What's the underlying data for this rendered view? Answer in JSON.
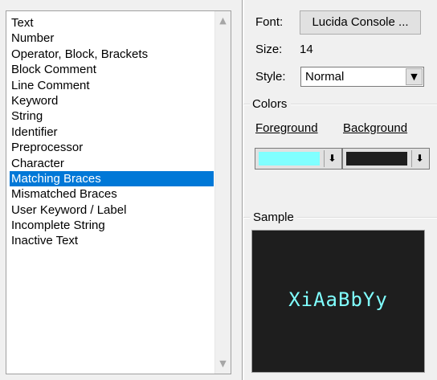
{
  "list": {
    "items": [
      "Text",
      "Number",
      "Operator, Block, Brackets",
      "Block Comment",
      "Line Comment",
      "Keyword",
      "String",
      "Identifier",
      "Preprocessor",
      "Character",
      "Matching Braces",
      "Mismatched Braces",
      "User Keyword / Label",
      "Incomplete String",
      "Inactive Text"
    ],
    "selected_index": 10
  },
  "font": {
    "label": "Font:",
    "button": "Lucida Console ..."
  },
  "size": {
    "label": "Size:",
    "value": "14"
  },
  "style": {
    "label": "Style:",
    "value": "Normal"
  },
  "colors": {
    "group_label": "Colors",
    "foreground_label": "Foreground",
    "background_label": "Background",
    "foreground_color": "#80ffff",
    "background_color": "#1e1e1e"
  },
  "sample": {
    "group_label": "Sample",
    "text": "XiAaBbYy",
    "text_color": "#80ffff",
    "bg_color": "#1e1e1e"
  },
  "icons": {
    "scroll_up": "scroll-up-arrow-icon",
    "scroll_down": "scroll-down-arrow-icon",
    "dropdown": "dropdown-arrow-icon",
    "color_dropdown": "color-dropdown-arrow-icon"
  },
  "accent_color": "#0078d7"
}
